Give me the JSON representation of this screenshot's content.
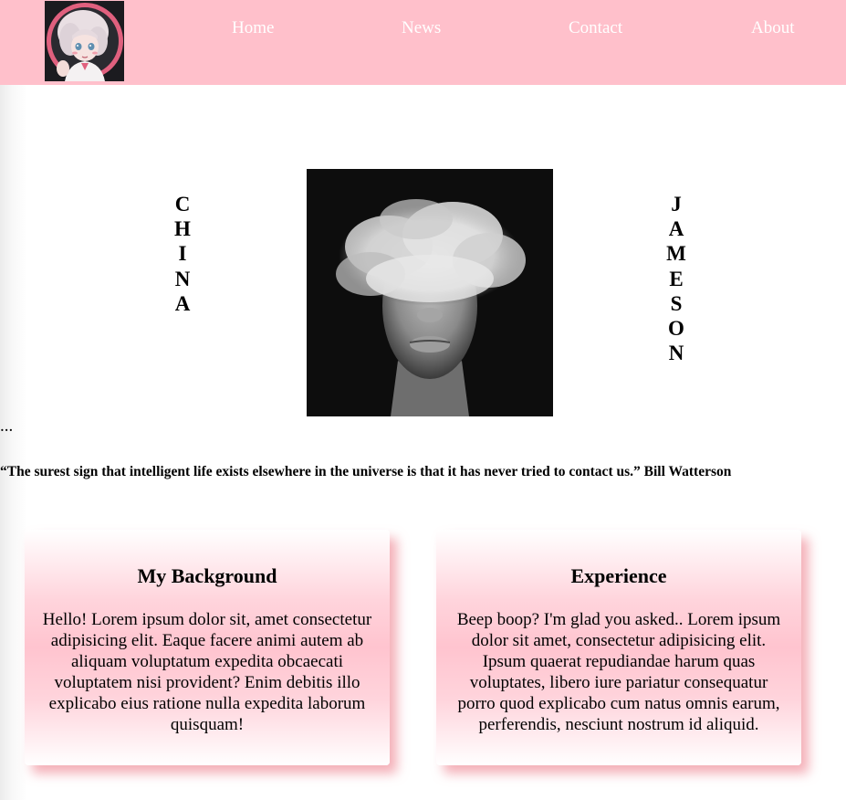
{
  "nav": {
    "logo_alt": "anime avatar logo",
    "links": [
      "Home",
      "News",
      "Contact",
      "About"
    ]
  },
  "hero": {
    "left_name": [
      "C",
      "H",
      "I",
      "N",
      "A"
    ],
    "right_name": [
      "J",
      "A",
      "M",
      "E",
      "S",
      "O",
      "N"
    ],
    "image_desc_icon": "smoke-face-image"
  },
  "ellipsis": "...",
  "quote": "“The surest sign that intelligent life exists elsewhere in the universe is that it has never tried to contact us.” Bill Watterson",
  "cards": [
    {
      "title": "My Background",
      "body": "Hello! Lorem ipsum dolor sit, amet consectetur adipisicing elit. Eaque facere animi autem ab aliquam voluptatum expedita obcaecati voluptatem nisi provident? Enim debitis illo explicabo eius ratione nulla expedita laborum quisquam!"
    },
    {
      "title": "Experience",
      "body": "Beep boop? I'm glad you asked.. Lorem ipsum dolor sit amet, consectetur adipisicing elit. Ipsum quaerat repudiandae harum quas voluptates, libero iure pariatur consequatur porro quod explicabo cum natus omnis earum, perferendis, nesciunt nostrum id aliquid."
    }
  ],
  "colors": {
    "nav_bg": "#ffc0cb",
    "nav_text": "#ffffff",
    "card_glow": "#f096a0"
  }
}
